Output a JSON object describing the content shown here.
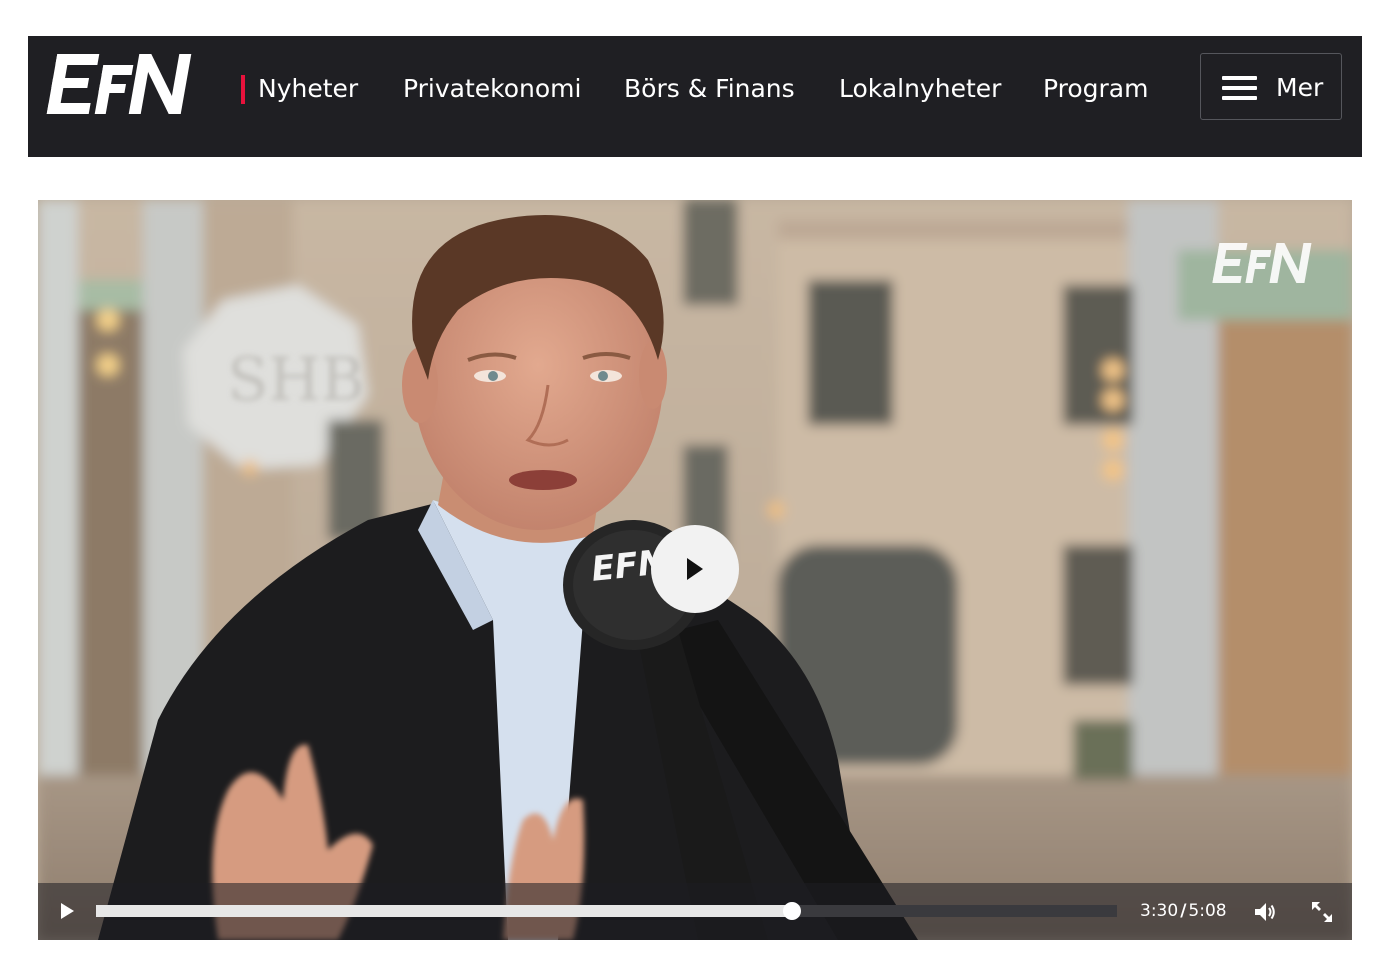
{
  "brand": {
    "logo_text": "EFN",
    "accent_color": "#e8123c",
    "header_bg": "#1f1f23"
  },
  "nav": {
    "items": [
      {
        "label": "Nyheter",
        "active": true
      },
      {
        "label": "Privatekonomi",
        "active": false
      },
      {
        "label": "Börs & Finans",
        "active": false
      },
      {
        "label": "Lokalnyheter",
        "active": false
      },
      {
        "label": "Program",
        "active": false
      }
    ],
    "more": {
      "label": "Mer",
      "icon": "hamburger-menu-icon"
    }
  },
  "video": {
    "watermark_text": "EFN",
    "mic_logo_text": "EFN",
    "sign_text": "SHB",
    "current_time": "3:30",
    "separator": "/",
    "duration": "5:08",
    "progress_fraction": 0.6818,
    "icons": {
      "big_play": "play-icon",
      "play": "play-icon",
      "volume": "volume-icon",
      "fullscreen": "fullscreen-icon"
    }
  }
}
